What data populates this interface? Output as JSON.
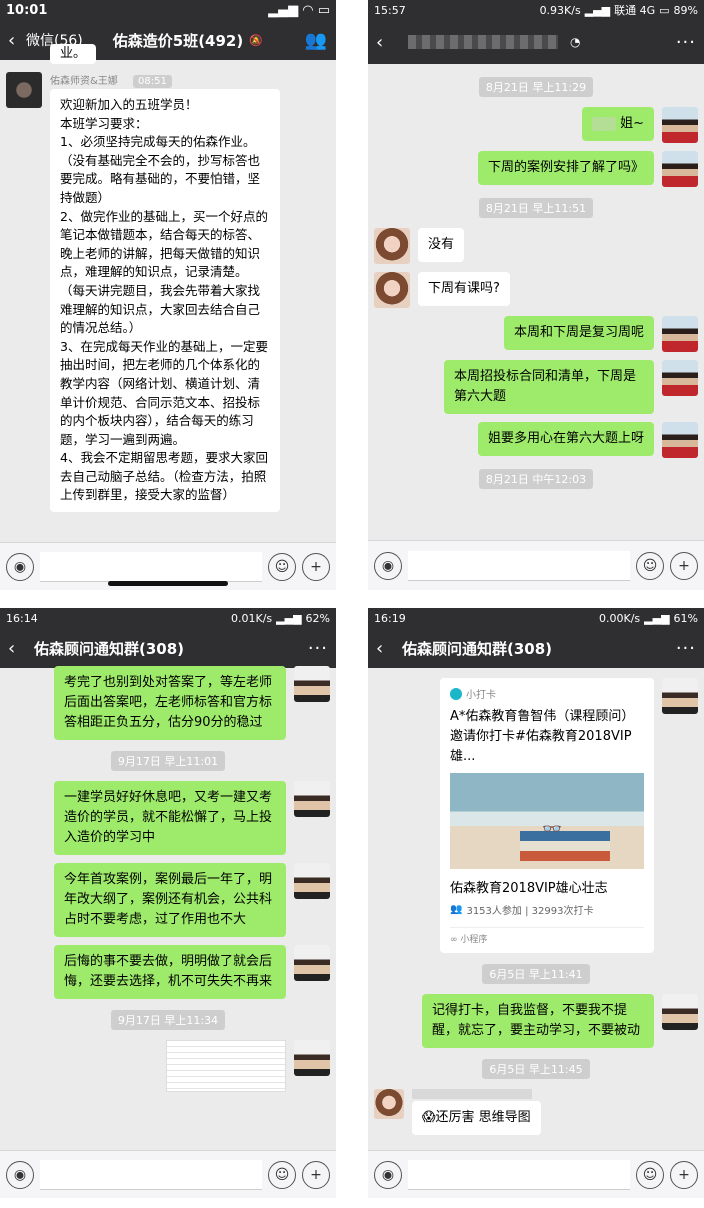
{
  "p1": {
    "status": {
      "time": "10:01"
    },
    "header": {
      "back_label": "微信(56)",
      "title": "佑森造价5班(492)"
    },
    "prev_fragment": "业。",
    "message": {
      "sender": "佑森师资&王娜",
      "time": "08:51",
      "text": "欢迎新加入的五班学员！\n本班学习要求：\n1、必须坚持完成每天的佑森作业。（没有基础完全不会的，抄写标答也要完成。略有基础的，不要怕错，坚持做题）\n2、做完作业的基础上，买一个好点的笔记本做错题本，结合每天的标答、晚上老师的讲解，把每天做错的知识点，难理解的知识点，记录清楚。\n（每天讲完题目，我会先带着大家找难理解的知识点，大家回去结合自己的情况总结。）\n3、在完成每天作业的基础上，一定要抽出时间，把左老师的几个体系化的教学内容（网络计划、横道计划、清单计价规范、合同示范文本、招投标的内个板块内容），结合每天的练习题，学习一遍到两遍。\n4、我会不定期留思考题，要求大家回去自己动脑子总结。（检查方法，拍照上传到群里，接受大家的监督）"
    }
  },
  "p2": {
    "status": {
      "time": "15:57",
      "speed": "0.93K/s",
      "carrier": "联通 4G",
      "battery": "89%"
    },
    "messages": [
      {
        "kind": "time",
        "text": "8月21日 早上11:29"
      },
      {
        "kind": "out",
        "text": "姐~"
      },
      {
        "kind": "out",
        "text": "下周的案例安排了解了吗》"
      },
      {
        "kind": "time",
        "text": "8月21日 早上11:51"
      },
      {
        "kind": "in",
        "text": "没有"
      },
      {
        "kind": "in",
        "text": "下周有课吗?"
      },
      {
        "kind": "out",
        "text": "本周和下周是复习周呢"
      },
      {
        "kind": "out",
        "text": "本周招投标合同和清单，下周是第六大题"
      },
      {
        "kind": "out",
        "text": "姐要多用心在第六大题上呀"
      },
      {
        "kind": "time",
        "text": "8月21日 中午12:03"
      }
    ]
  },
  "p3": {
    "status": {
      "time": "16:14",
      "speed": "0.01K/s",
      "battery": "62%"
    },
    "header": {
      "title": "佑森顾问通知群(308)"
    },
    "messages": [
      {
        "kind": "out",
        "text": "考完了也别到处对答案了，等左老师后面出答案吧，左老师标答和官方标答相距正负五分，估分90分的稳过"
      },
      {
        "kind": "time",
        "text": "9月17日 早上11:01"
      },
      {
        "kind": "out",
        "text": "一建学员好好休息吧，又考一建又考造价的学员，就不能松懈了，马上投入造价的学习中"
      },
      {
        "kind": "out",
        "text": "今年首攻案例，案例最后一年了，明年改大纲了，案例还有机会，公共科占时不要考虑，过了作用也不大"
      },
      {
        "kind": "out",
        "text": "后悔的事不要去做，明明做了就会后悔，还要去选择，机不可失失不再来"
      },
      {
        "kind": "time",
        "text": "9月17日 早上11:34"
      }
    ]
  },
  "p4": {
    "status": {
      "time": "16:19",
      "speed": "0.00K/s",
      "battery": "61%"
    },
    "header": {
      "title": "佑森顾问通知群(308)"
    },
    "card": {
      "app": "小打卡",
      "title": "A*佑森教育鲁智伟（课程顾问）邀请你打卡#佑森教育2018VIP雄...",
      "name": "佑森教育2018VIP雄心壮志",
      "stats": "3153人参加 | 32993次打卡",
      "footer": "小程序"
    },
    "time1": "6月5日 早上11:41",
    "reminder": "记得打卡，自我监督，不要我不提醒，就忘了，要主动学习，不要被动",
    "time2": "6月5日 早上11:45",
    "reply": "😱还厉害 思维导图"
  }
}
